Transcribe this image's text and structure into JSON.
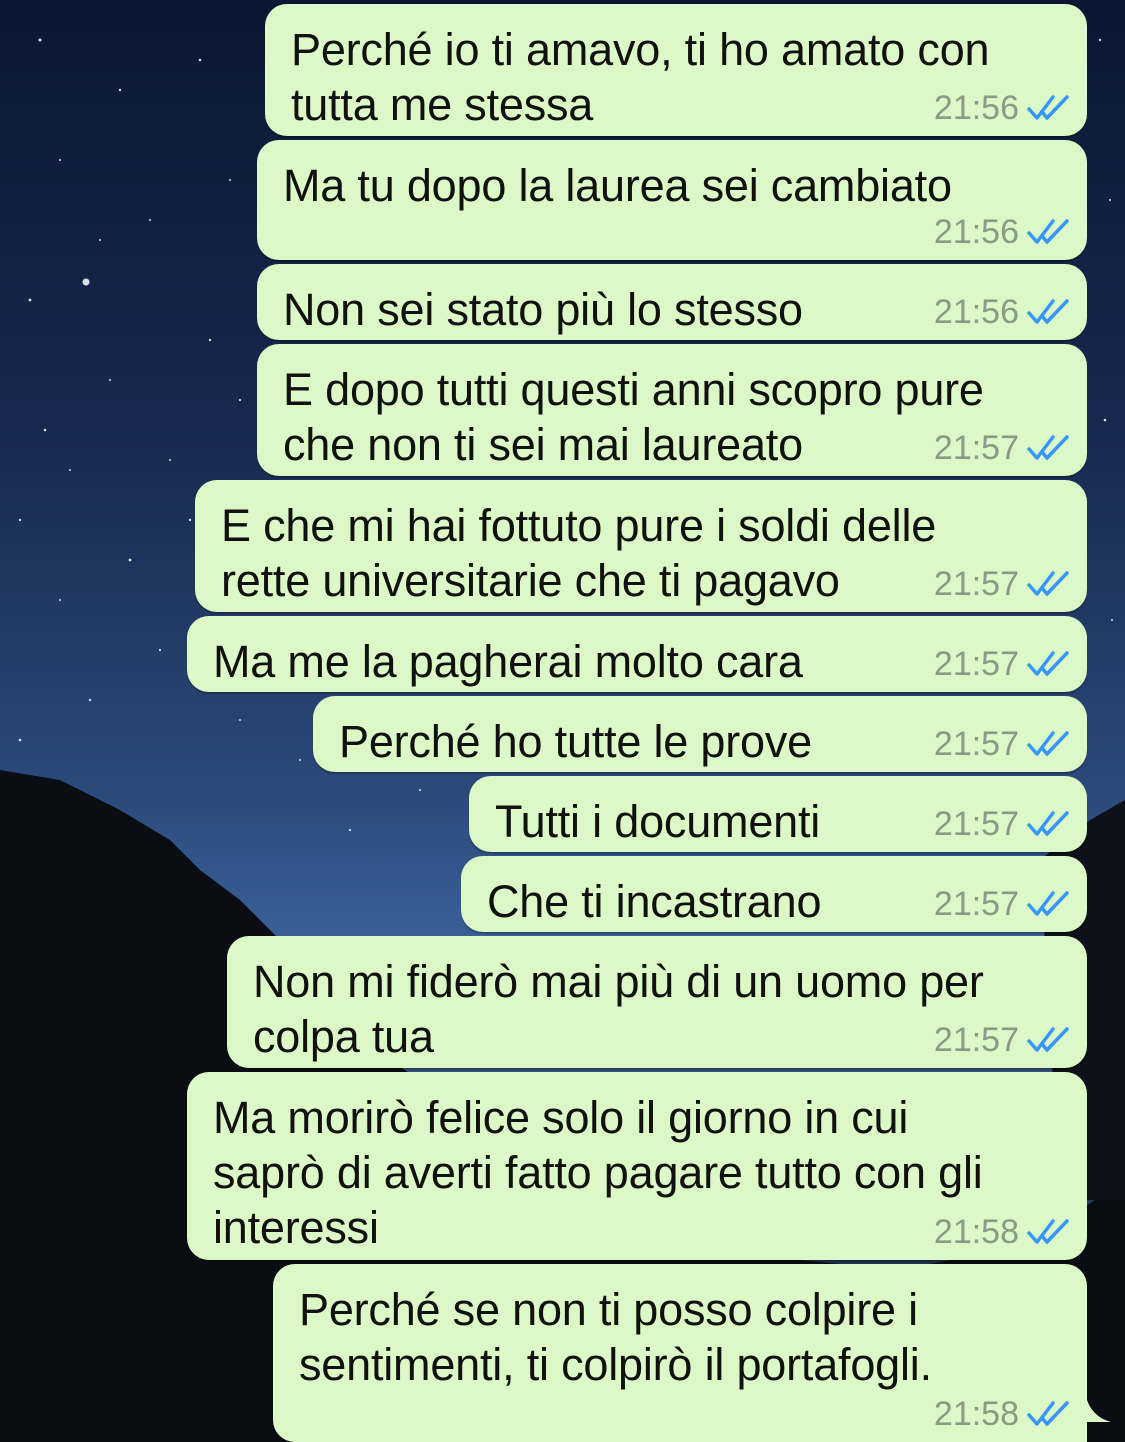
{
  "colors": {
    "bubble": "#dcf8c6",
    "time": "#8a9a86",
    "read_ticks": "#3497f9"
  },
  "messages": [
    {
      "text": "Perché io ti amavo, ti ho amato con\ntutta me stessa",
      "time": "21:56",
      "status_icon": "double-check-read-icon"
    },
    {
      "text": "Ma tu dopo la laurea sei cambiato",
      "time": "21:56",
      "status_icon": "double-check-read-icon"
    },
    {
      "text": "Non sei stato più lo stesso",
      "time": "21:56",
      "status_icon": "double-check-read-icon"
    },
    {
      "text": "E dopo tutti questi anni scopro pure\nche non ti sei mai laureato",
      "time": "21:57",
      "status_icon": "double-check-read-icon"
    },
    {
      "text": "E che mi hai fottuto pure i soldi delle\nrette universitarie che ti pagavo",
      "time": "21:57",
      "status_icon": "double-check-read-icon"
    },
    {
      "text": "Ma me la pagherai molto cara",
      "time": "21:57",
      "status_icon": "double-check-read-icon"
    },
    {
      "text": "Perché ho tutte le prove",
      "time": "21:57",
      "status_icon": "double-check-read-icon"
    },
    {
      "text": "Tutti i documenti",
      "time": "21:57",
      "status_icon": "double-check-read-icon"
    },
    {
      "text": "Che ti incastrano",
      "time": "21:57",
      "status_icon": "double-check-read-icon"
    },
    {
      "text": "Non mi fiderò mai più di un uomo per\ncolpa tua",
      "time": "21:57",
      "status_icon": "double-check-read-icon"
    },
    {
      "text": "Ma morirò felice solo il giorno in cui\nsaprò di averti fatto pagare tutto con gli\ninteressi",
      "time": "21:58",
      "status_icon": "double-check-read-icon"
    },
    {
      "text": "Perché se non ti posso colpire i\nsentimenti, ti colpirò il portafogli.",
      "time": "21:58",
      "status_icon": "double-check-read-icon"
    }
  ]
}
